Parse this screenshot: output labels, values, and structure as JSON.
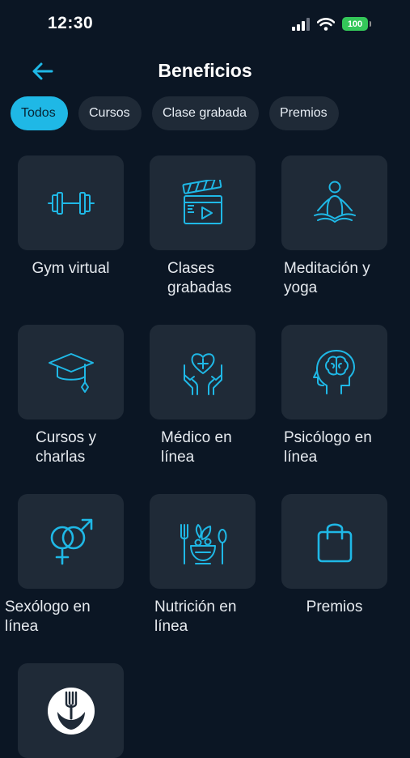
{
  "status_bar": {
    "time": "12:30",
    "battery": "100"
  },
  "header": {
    "title": "Beneficios"
  },
  "tabs": [
    {
      "label": "Todos",
      "active": true
    },
    {
      "label": "Cursos",
      "active": false
    },
    {
      "label": "Clase grabada",
      "active": false
    },
    {
      "label": "Premios",
      "active": false
    }
  ],
  "benefits": [
    {
      "label_line1": "Gym virtual",
      "label_line2": "",
      "icon": "dumbbell-icon"
    },
    {
      "label_line1": "Clases",
      "label_line2": "grabadas",
      "icon": "clapperboard-icon"
    },
    {
      "label_line1": "Meditación y",
      "label_line2": "yoga",
      "icon": "meditation-icon"
    },
    {
      "label_line1": "Cursos y",
      "label_line2": "charlas",
      "icon": "graduation-cap-icon"
    },
    {
      "label_line1": "Médico en",
      "label_line2": "línea",
      "icon": "hands-heart-icon"
    },
    {
      "label_line1": "Psicólogo en",
      "label_line2": "línea",
      "icon": "head-brain-icon"
    },
    {
      "label_line1": "Sexólogo en",
      "label_line2": "línea",
      "icon": "gender-symbols-icon"
    },
    {
      "label_line1": "Nutrición en",
      "label_line2": "línea",
      "icon": "salad-bowl-icon"
    },
    {
      "label_line1": "Premios",
      "label_line2": "",
      "icon": "shopping-bag-icon"
    },
    {
      "label_line1": "",
      "label_line2": "",
      "icon": "nutrition-logo-icon"
    }
  ],
  "colors": {
    "background": "#0b1624",
    "tile": "#1f2a37",
    "accent": "#1fb8e6",
    "battery": "#34c759"
  }
}
